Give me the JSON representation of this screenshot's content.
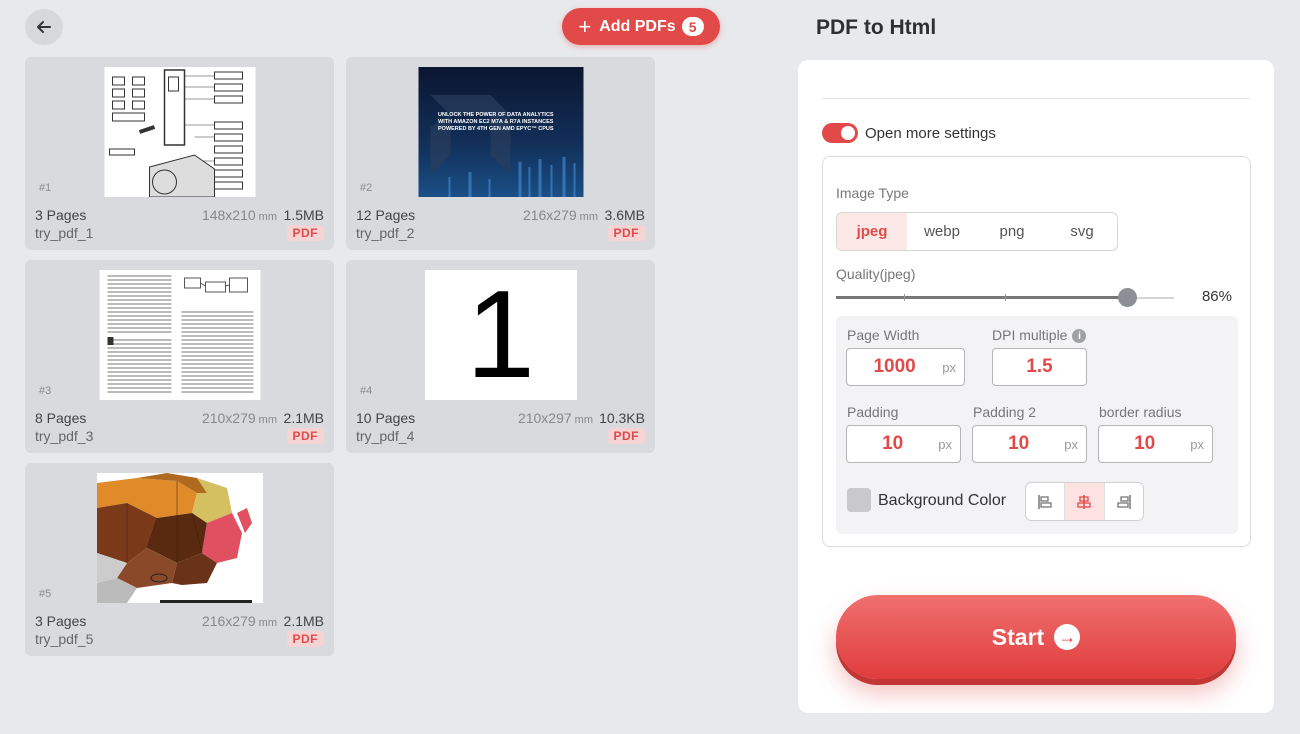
{
  "header": {
    "add_label": "Add PDFs",
    "add_count": "5",
    "title": "PDF to Html"
  },
  "files": [
    {
      "num": "#1",
      "pages": "3 Pages",
      "name": "try_pdf_1",
      "dims": "148x210",
      "unit": "mm",
      "size": "1.5MB",
      "tag": "PDF"
    },
    {
      "num": "#2",
      "pages": "12 Pages",
      "name": "try_pdf_2",
      "dims": "216x279",
      "unit": "mm",
      "size": "3.6MB",
      "tag": "PDF",
      "thumb_text": "UNLOCK THE POWER OF DATA ANALYTICS WITH AMAZON EC2 M7A & R7A INSTANCES POWERED BY 4TH GEN AMD EPYC™ CPUS"
    },
    {
      "num": "#3",
      "pages": "8 Pages",
      "name": "try_pdf_3",
      "dims": "210x279",
      "unit": "mm",
      "size": "2.1MB",
      "tag": "PDF"
    },
    {
      "num": "#4",
      "pages": "10 Pages",
      "name": "try_pdf_4",
      "dims": "210x297",
      "unit": "mm",
      "size": "10.3KB",
      "tag": "PDF",
      "thumb_text": "1"
    },
    {
      "num": "#5",
      "pages": "3 Pages",
      "name": "try_pdf_5",
      "dims": "216x279",
      "unit": "mm",
      "size": "2.1MB",
      "tag": "PDF"
    }
  ],
  "settings": {
    "toggle_label": "Open more settings",
    "toggle_on": true,
    "image_type_label": "Image Type",
    "image_types": [
      "jpeg",
      "webp",
      "png",
      "svg"
    ],
    "selected_type": "jpeg",
    "quality_label": "Quality(jpeg)",
    "quality_value": "86%",
    "quality_fraction": 0.86,
    "page_width_label": "Page Width",
    "page_width": "1000",
    "dpi_label": "DPI multiple",
    "dpi": "1.5",
    "padding_label": "Padding",
    "padding": "10",
    "padding2_label": "Padding 2",
    "padding2": "10",
    "radius_label": "border radius",
    "radius": "10",
    "unit_px": "px",
    "bg_label": "Background Color",
    "bg_color": "#c9c9cc",
    "align_options": [
      "align-left-icon",
      "align-center-icon",
      "align-right-icon"
    ],
    "align_selected": "center"
  },
  "start_label": "Start",
  "colors": {
    "accent": "#e24a4a",
    "background": "#e8e9ec",
    "panel": "#ffffff"
  }
}
